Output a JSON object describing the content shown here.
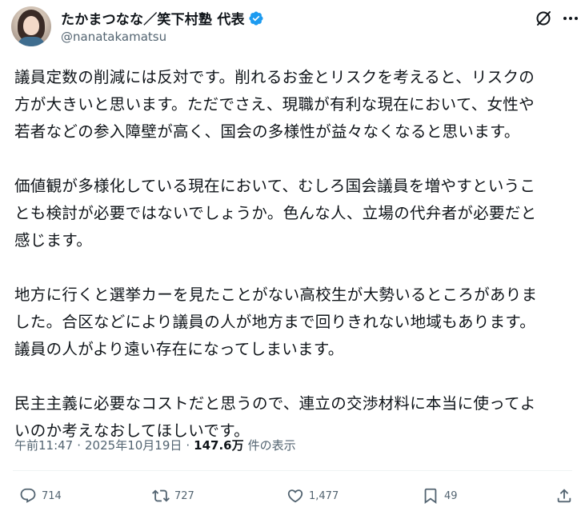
{
  "author": {
    "display_name": "たかまつなな／笑下村塾 代表",
    "handle": "@nanatakamatsu",
    "verified": true
  },
  "tweet": {
    "paragraphs": [
      "議員定数の削減には反対です。削れるお金とリスクを考えると、リスクの\n方が大きいと思います。ただでさえ、現職が有利な現在において、女性や\n若者などの参入障壁が高く、国会の多様性が益々なくなると思います。",
      "価値観が多様化している現在において、むしろ国会議員を増やすというこ\nとも検討が必要ではないでしょうか。色んな人、立場の代弁者が必要だと\n感じます。",
      "地方に行くと選挙カーを見たことがない高校生が大勢いるところがありま\nした。合区などにより議員の人が地方まで回りきれない地域もあります。\n議員の人がより遠い存在になってしまいます。",
      "民主主義に必要なコストだと思うので、連立の交渉材料に本当に使ってよ\nいのか考えなおしてほしいです。"
    ],
    "time": "午前11:47",
    "separator": "·",
    "date": "2025年10月19日",
    "views_count": "147.6万",
    "views_label": "件の表示"
  },
  "actions": {
    "replies": "714",
    "reposts": "727",
    "likes": "1,477",
    "bookmarks": "49"
  },
  "icons": {
    "verified": "verified-badge-icon",
    "grok": "grok-icon",
    "more": "more-icon",
    "reply": "reply-icon",
    "repost": "repost-icon",
    "like": "like-icon",
    "bookmark": "bookmark-icon",
    "share": "share-icon"
  },
  "colors": {
    "verified_blue": "#1d9bf0",
    "text_primary": "#0f1419",
    "text_secondary": "#536471"
  }
}
